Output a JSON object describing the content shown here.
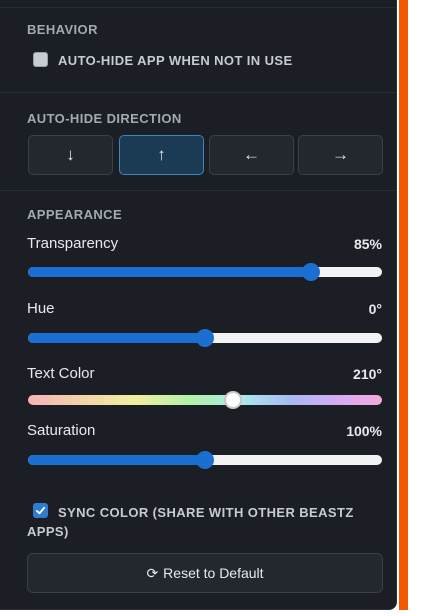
{
  "behavior": {
    "title": "BEHAVIOR",
    "auto_hide_label": "AUTO-HIDE APP WHEN NOT IN USE",
    "auto_hide_checked": false
  },
  "direction": {
    "title": "AUTO-HIDE DIRECTION",
    "buttons": [
      {
        "glyph": "↓",
        "icon": "arrow-down-icon",
        "active": false
      },
      {
        "glyph": "↑",
        "icon": "arrow-up-icon",
        "active": true
      },
      {
        "glyph": "←",
        "icon": "arrow-left-icon",
        "active": false
      },
      {
        "glyph": "→",
        "icon": "arrow-right-icon",
        "active": false
      }
    ]
  },
  "appearance": {
    "title": "APPEARANCE",
    "sliders": [
      {
        "label": "Transparency",
        "value_text": "85%",
        "fraction": 0.8,
        "style": "solid"
      },
      {
        "label": "Hue",
        "value_text": "0°",
        "fraction": 0.5,
        "style": "solid"
      },
      {
        "label": "Text Color",
        "value_text": "210°",
        "fraction": 0.58,
        "style": "rainbow"
      },
      {
        "label": "Saturation",
        "value_text": "100%",
        "fraction": 0.5,
        "style": "solid"
      }
    ]
  },
  "sync": {
    "label": "SYNC COLOR (SHARE WITH OTHER BEASTZ APPS)",
    "checked": true
  },
  "reset": {
    "icon": "refresh-icon",
    "icon_glyph": "⟳",
    "label": "Reset to Default"
  },
  "colors": {
    "panel_bg": "#1b1e24",
    "accent": "#f05a00",
    "slider_fill": "#1a6fd0",
    "active_button": "#1b3a53"
  }
}
